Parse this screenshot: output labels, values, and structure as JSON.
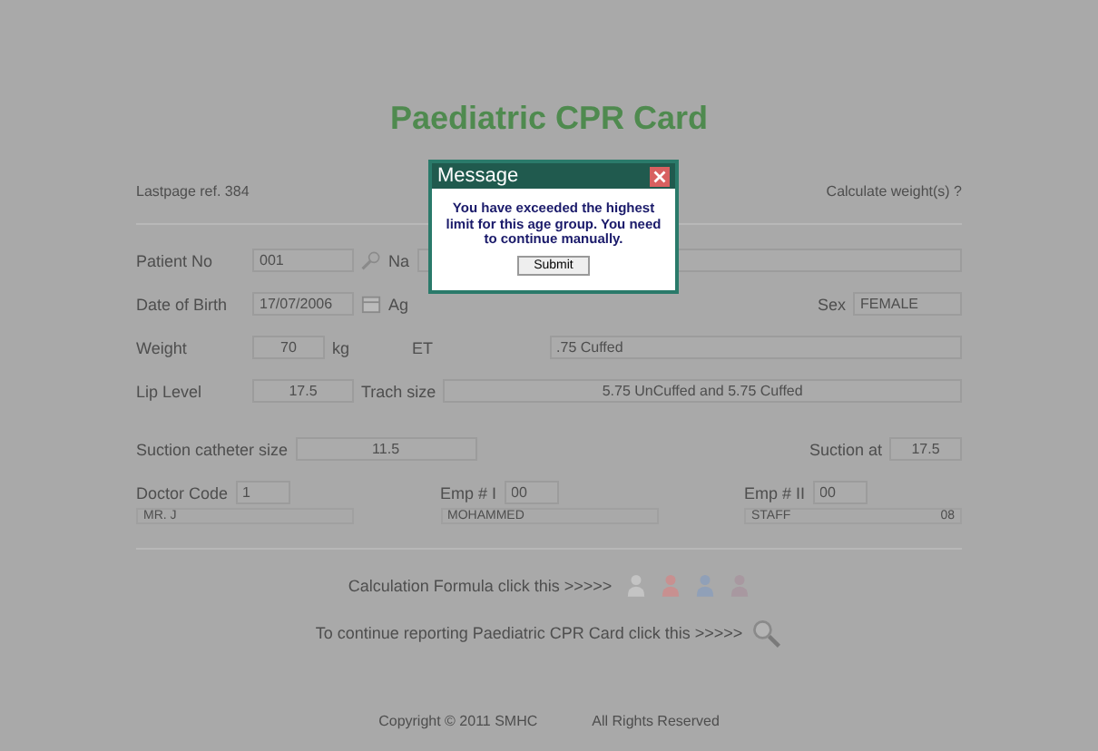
{
  "title": "Paediatric CPR Card",
  "header": {
    "reference": "Lastpage ref. 384",
    "link": "Calculate weight(s) ?"
  },
  "patient": {
    "patient_no_label": "Patient No",
    "patient_no": "001",
    "name_label": "Na"
  },
  "birth": {
    "dob_label": "Date of Birth",
    "dob": "17/07/2006",
    "age_label": "Ag",
    "sex_label": "Sex",
    "sex": "FEMALE"
  },
  "weight": {
    "label": "Weight",
    "value": "70",
    "unit": "kg",
    "ett_label": "ET",
    "ett": ".75 Cuffed"
  },
  "lip": {
    "label": "Lip Level",
    "value": "17.5",
    "trach_label": "Trach size",
    "trach": "5.75 UnCuffed and 5.75 Cuffed"
  },
  "suction": {
    "catheter_label": "Suction catheter size",
    "catheter": "11.5",
    "at_label": "Suction at",
    "at": "17.5"
  },
  "staff": [
    {
      "label": "Doctor Code",
      "value": "1",
      "sub": "MR. J"
    },
    {
      "label": "Emp # I",
      "value": "00",
      "sub": "MOHAMMED"
    },
    {
      "label": "Emp # II",
      "value": "00",
      "sub": "STAFF",
      "sub_value": "08"
    }
  ],
  "calc": {
    "text": "Calculation Formula click this >>>>>",
    "icons": [
      {
        "color": "#c4c4c4"
      },
      {
        "color": "#c89090"
      },
      {
        "color": "#90a0b8"
      },
      {
        "color": "#a898a0"
      }
    ]
  },
  "continue_text": "To continue reporting Paediatric CPR Card click this >>>>>",
  "footer": {
    "copyright": "Copyright © 2011 SMHC",
    "rights": "All Rights Reserved"
  },
  "dialog": {
    "title": "Message",
    "message": "You have exceeded the highest limit for this age group. You need to continue manually.",
    "button": "Submit"
  }
}
